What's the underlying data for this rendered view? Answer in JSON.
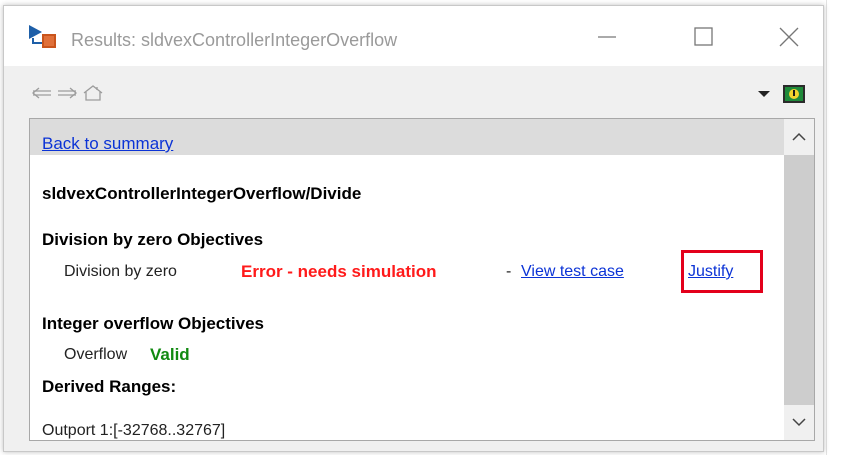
{
  "window": {
    "title": "Results: sldvexControllerIntegerOverflow"
  },
  "titlebar_icons": {
    "app": "simulink-model-icon",
    "minimize": "minimize-icon",
    "maximize": "maximize-icon",
    "close": "close-icon"
  },
  "toolbar": {
    "back": "back-arrow-icon",
    "forward": "forward-arrow-icon",
    "home": "home-icon",
    "menu": "dropdown-arrow-icon",
    "help": "help-icon"
  },
  "content": {
    "back_link": "Back to summary",
    "path": "sldvexControllerIntegerOverflow/Divide",
    "division_section": {
      "heading": "Division by zero Objectives",
      "objective": "Division by zero",
      "status": "Error - needs simulation",
      "separator": "-",
      "view_link": "View test case",
      "justify_link": "Justify"
    },
    "overflow_section": {
      "heading": "Integer overflow Objectives",
      "objective": "Overflow",
      "status": "Valid"
    },
    "ranges_heading": "Derived Ranges:",
    "outport": "Outport 1:[-32768..32767]"
  },
  "colors": {
    "link": "#0b33d6",
    "error": "#ff1a1a",
    "valid": "#118a11",
    "highlight_box": "#e3001b"
  }
}
